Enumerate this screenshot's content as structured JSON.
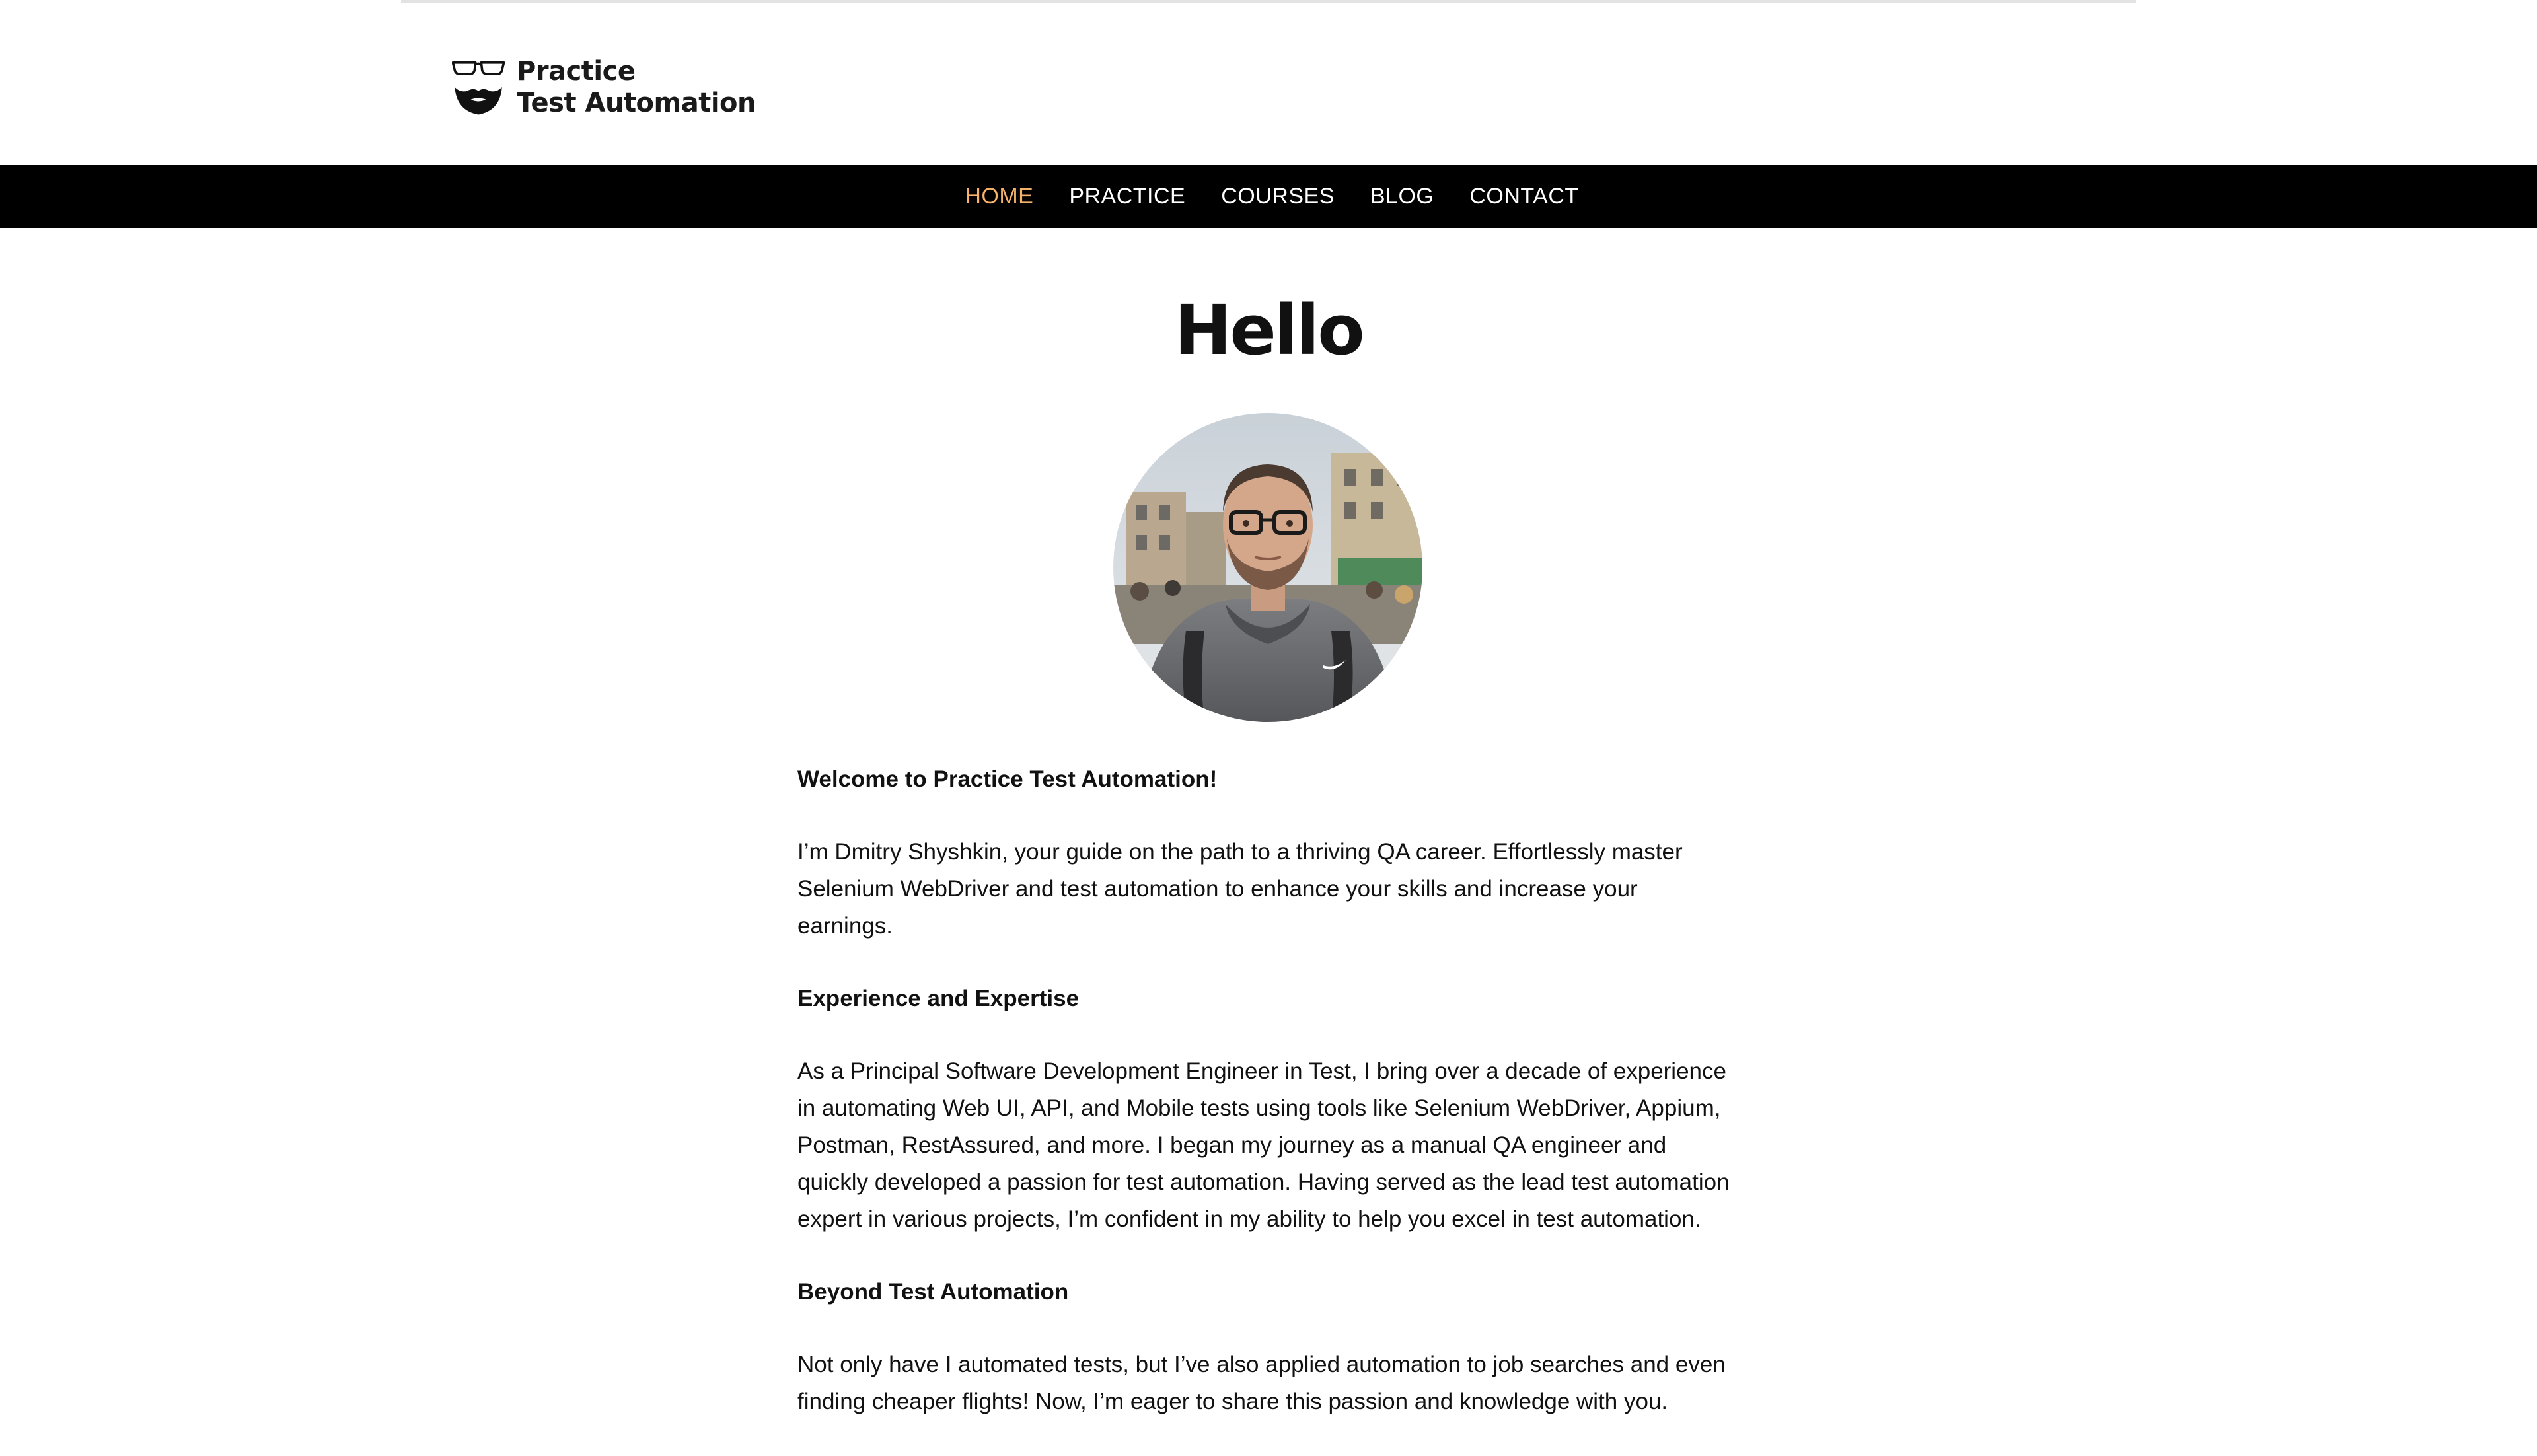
{
  "site": {
    "logo_line1": "Practice",
    "logo_line2": "Test Automation"
  },
  "nav": {
    "items": [
      {
        "label": "HOME",
        "active": true
      },
      {
        "label": "PRACTICE",
        "active": false
      },
      {
        "label": "COURSES",
        "active": false
      },
      {
        "label": "BLOG",
        "active": false
      },
      {
        "label": "CONTACT",
        "active": false
      }
    ]
  },
  "main": {
    "title": "Hello",
    "welcome_heading": "Welcome to Practice Test Automation!",
    "intro": "I’m Dmitry Shyshkin, your guide on the path to a thriving QA career. Effortlessly master Selenium WebDriver and test automation to enhance your skills and increase your earnings.",
    "experience_heading": "Experience and Expertise",
    "experience_text": "As a Principal Software Development Engineer in Test, I bring over a decade of experience in automating Web UI, API, and Mobile tests using tools like Selenium WebDriver, Appium, Postman, RestAssured, and more. I began my journey as a manual QA engineer and quickly developed a passion for test automation. Having served as the lead test automation expert in various projects, I’m confident in my ability to help you excel in test automation.",
    "beyond_heading": "Beyond Test Automation",
    "beyond_text": "Not only have I automated tests, but I’ve also applied automation to job searches and even finding cheaper flights! Now, I’m eager to share this passion and knowledge with you."
  },
  "colors": {
    "nav_background": "#000000",
    "nav_active": "#f6b26b",
    "nav_text": "#ffffff",
    "text": "#111111"
  },
  "icons": {
    "logo": "glasses-beard-logo-icon",
    "avatar": "author-avatar-photo"
  }
}
